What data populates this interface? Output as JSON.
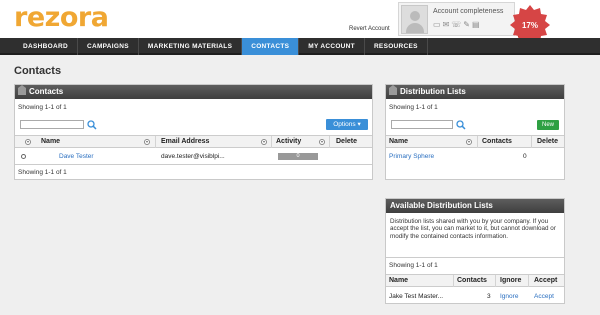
{
  "brand": {
    "logo": "rezora",
    "color": "#f0a733"
  },
  "header": {
    "revert_link": "Revert Account",
    "account_label": "Account completeness",
    "completeness": "17%",
    "completeness_value": 17,
    "icons": [
      "id-card-icon",
      "email-icon",
      "phone-icon",
      "edit-icon",
      "document-icon"
    ]
  },
  "nav": {
    "items": [
      "DASHBOARD",
      "CAMPAIGNS",
      "MARKETING MATERIALS",
      "CONTACTS",
      "MY ACCOUNT",
      "RESOURCES"
    ],
    "active": "CONTACTS",
    "active_color": "#3a8fd8"
  },
  "page": {
    "title": "Contacts"
  },
  "contacts": {
    "title": "Contacts",
    "showing_top": "Showing 1-1 of 1",
    "showing_bottom": "Showing 1-1 of 1",
    "options_label": "Options ▾",
    "columns": [
      "Name",
      "Email Address",
      "Activity",
      "Delete"
    ],
    "rows": [
      {
        "name": "Dave Tester",
        "email": "dave.tester@visiblpi...",
        "activity": "0"
      }
    ]
  },
  "distribution": {
    "title": "Distribution Lists",
    "showing": "Showing 1-1 of 1",
    "new_label": "New",
    "columns": [
      "Name",
      "Contacts",
      "Delete"
    ],
    "rows": [
      {
        "name": "Primary Sphere",
        "contacts": "0"
      }
    ]
  },
  "available": {
    "title": "Available Distribution Lists",
    "description": "Distribution lists shared with you by your company. If you accept the list, you can market to it, but cannot download or modify the contained contacts information.",
    "showing": "Showing 1-1 of 1",
    "columns": [
      "Name",
      "Contacts",
      "Ignore",
      "Accept"
    ],
    "rows": [
      {
        "name": "Jake Test Master...",
        "contacts": "3",
        "ignore": "Ignore",
        "accept": "Accept"
      }
    ]
  }
}
